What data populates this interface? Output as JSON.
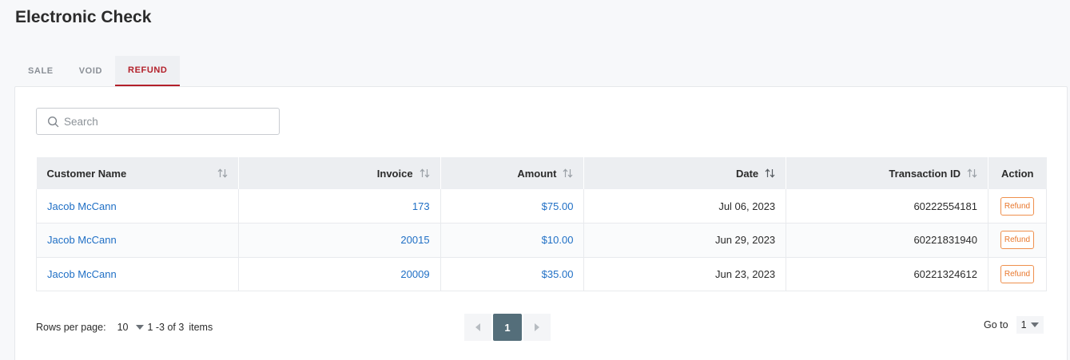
{
  "page": {
    "title": "Electronic Check"
  },
  "tabs": [
    {
      "label": "SALE",
      "active": false
    },
    {
      "label": "VOID",
      "active": false
    },
    {
      "label": "REFUND",
      "active": true
    }
  ],
  "search": {
    "placeholder": "Search",
    "value": ""
  },
  "table": {
    "columns": [
      "Customer Name",
      "Invoice",
      "Amount",
      "Date",
      "Transaction ID",
      "Action"
    ],
    "rows": [
      {
        "customer": "Jacob McCann",
        "invoice": "173",
        "amount": "$75.00",
        "date": "Jul 06, 2023",
        "transaction_id": "60222554181",
        "action": "Refund"
      },
      {
        "customer": "Jacob McCann",
        "invoice": "20015",
        "amount": "$10.00",
        "date": "Jun 29, 2023",
        "transaction_id": "60221831940",
        "action": "Refund"
      },
      {
        "customer": "Jacob McCann",
        "invoice": "20009",
        "amount": "$35.00",
        "date": "Jun 23, 2023",
        "transaction_id": "60221324612",
        "action": "Refund"
      }
    ]
  },
  "pagination": {
    "rows_per_page_label": "Rows per page:",
    "rows_per_page": "10",
    "range": "1 -3 of 3",
    "items_label": "items",
    "current_page": "1",
    "goto_label": "Go to",
    "goto_value": "1"
  },
  "colors": {
    "accent": "#b3202a",
    "link": "#1f6fc5",
    "refund_button": "#e8772c",
    "active_page": "#546e7a"
  },
  "icons": {
    "search": "search-icon",
    "sort": "sort-icon",
    "dropdown": "caret-down-icon",
    "prev": "chevron-left-icon",
    "next": "chevron-right-icon"
  }
}
